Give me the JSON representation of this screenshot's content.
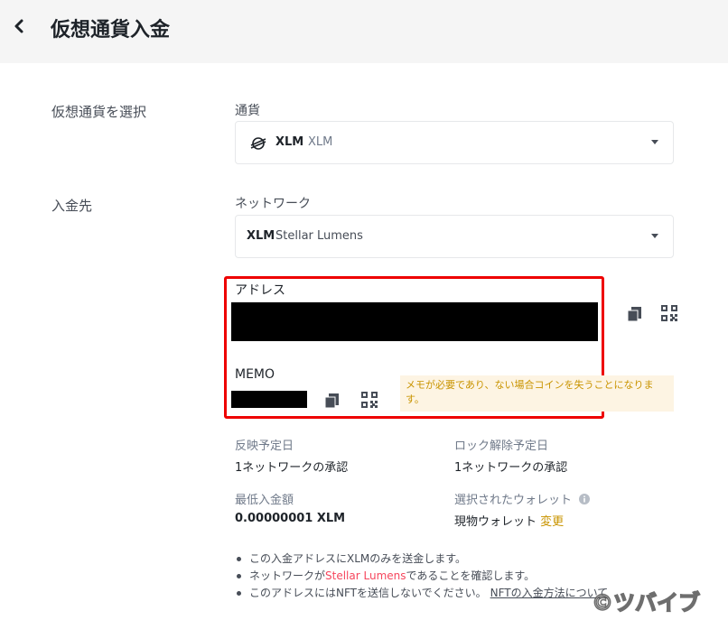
{
  "header": {
    "back_icon": "chevron-left-icon",
    "title": "仮想通貨入金"
  },
  "currency_section": {
    "side_label": "仮想通貨を選択",
    "field_label": "通貨",
    "selected_symbol": "XLM",
    "selected_name": "XLM",
    "coin_icon": "stellar-icon"
  },
  "destination_section": {
    "side_label": "入金先",
    "network_label": "ネットワーク",
    "network_symbol": "XLM",
    "network_name": "Stellar Lumens"
  },
  "address": {
    "label": "アドレス",
    "copy_icon": "copy-icon",
    "qr_icon": "qr-code-icon"
  },
  "memo": {
    "label": "MEMO",
    "warning": "メモが必要であり、ない場合コインを失うことになります。",
    "copy_icon": "copy-icon",
    "qr_icon": "qr-code-icon"
  },
  "info": {
    "reflect_label": "反映予定日",
    "reflect_value": "1ネットワークの承認",
    "unlock_label": "ロック解除予定日",
    "unlock_value": "1ネットワークの承認",
    "min_label": "最低入金額",
    "min_value": "0.00000001 XLM",
    "wallet_label": "選択されたウォレット",
    "wallet_value": "現物ウォレット",
    "wallet_change": "変更",
    "info_icon": "info-icon"
  },
  "notes": {
    "note1": "この入金アドレスにXLMのみを送金します。",
    "note2_pre": "ネットワークが",
    "note2_link": "Stellar Lumens",
    "note2_post": "であることを確認します。",
    "note3_pre": "このアドレスにはNFTを送信しないでください。",
    "note3_link": "NFTの入金方法について"
  },
  "watermark": "©ツバイブ",
  "colors": {
    "accent": "#c99400",
    "highlight_box": "#ee0000",
    "header_bg": "#f5f5f5",
    "link_red": "#f6465d"
  }
}
